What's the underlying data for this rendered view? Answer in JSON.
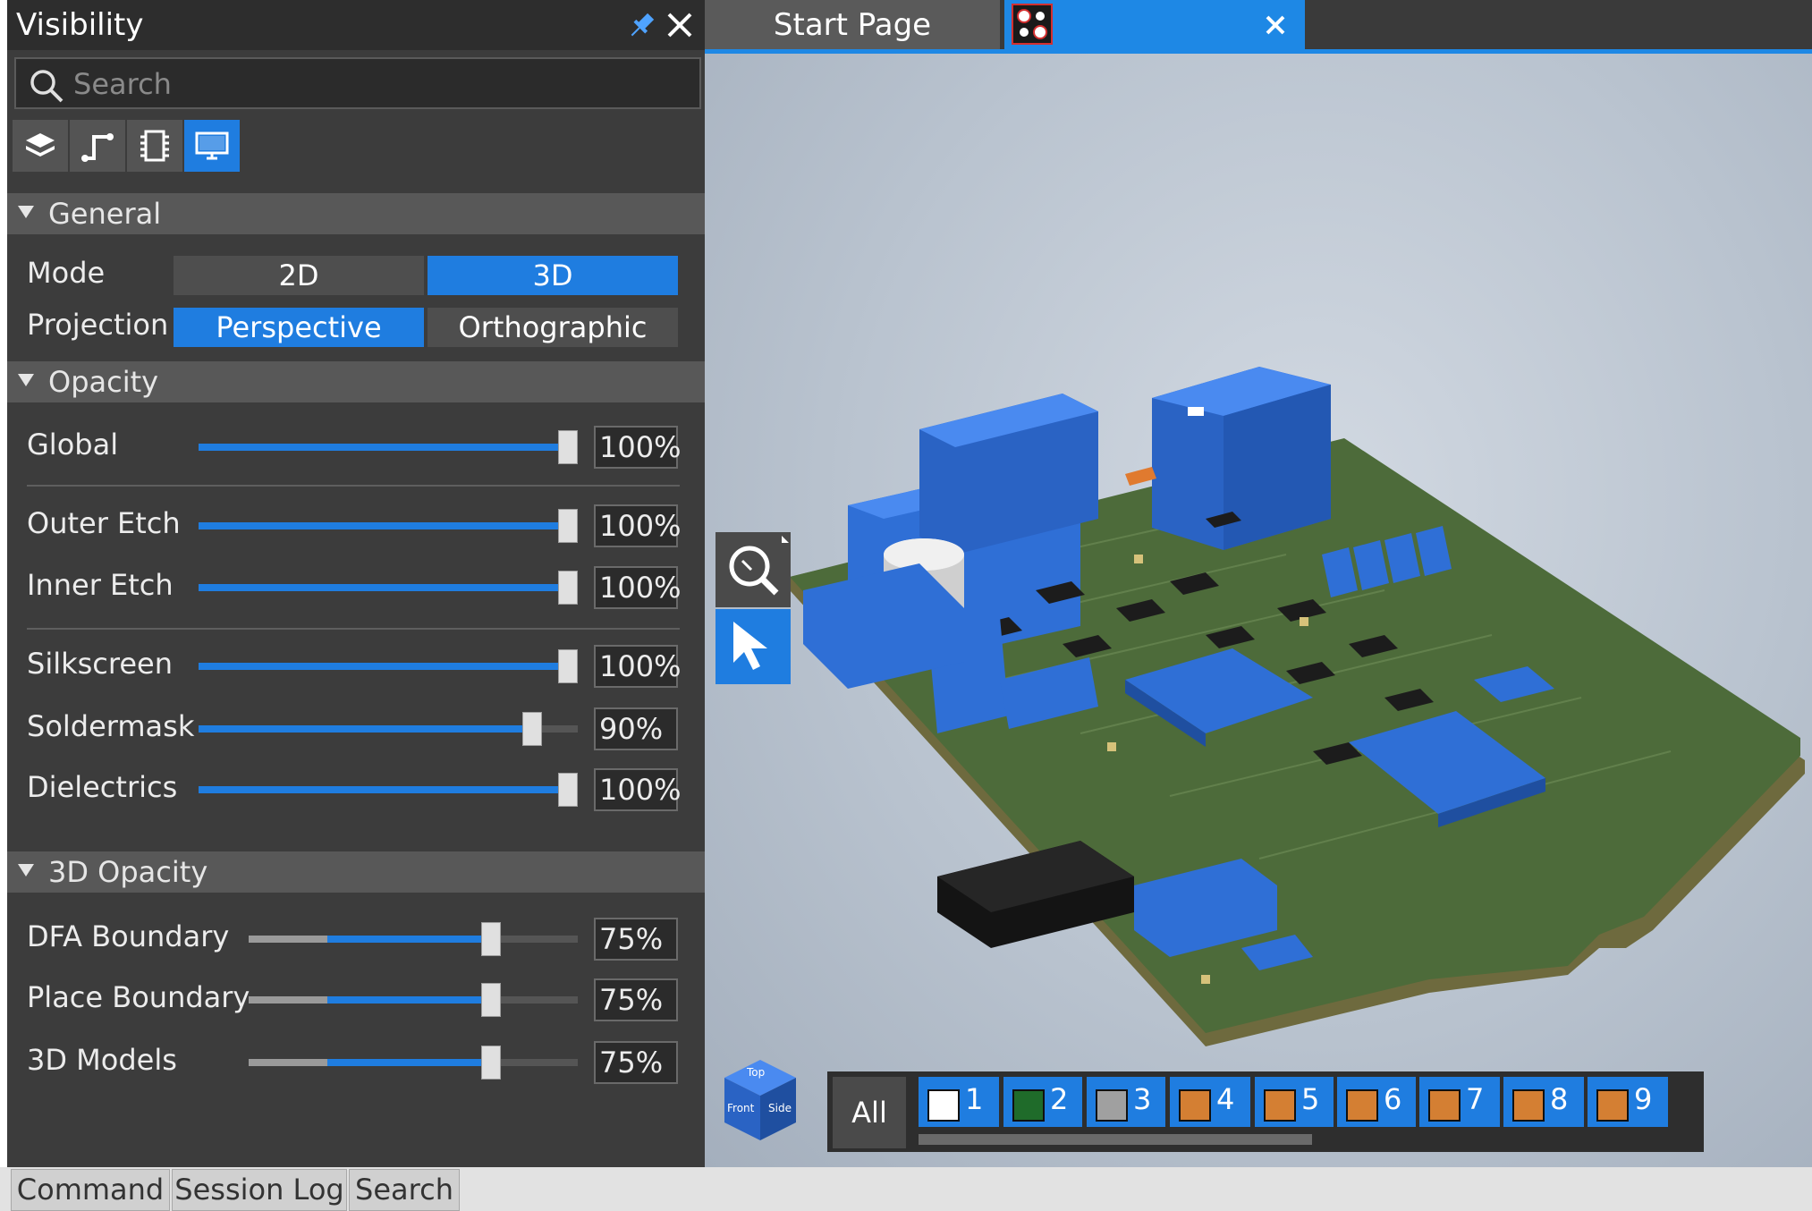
{
  "panel": {
    "title": "Visibility",
    "search_placeholder": "Search",
    "toolbar": [
      {
        "icon": "layers-icon",
        "active": false
      },
      {
        "icon": "trace-route-icon",
        "active": false
      },
      {
        "icon": "component-icon",
        "active": false
      },
      {
        "icon": "display-icon",
        "active": true
      }
    ]
  },
  "general": {
    "header": "General",
    "mode_label": "Mode",
    "mode_options": [
      "2D",
      "3D"
    ],
    "mode_selected": "3D",
    "projection_label": "Projection",
    "projection_options": [
      "Perspective",
      "Orthographic"
    ],
    "projection_selected": "Perspective"
  },
  "opacity": {
    "header": "Opacity",
    "items": [
      {
        "label": "Global",
        "value": "100%",
        "level": 1.0
      },
      {
        "label": "Outer Etch",
        "value": "100%",
        "level": 1.0
      },
      {
        "label": "Inner Etch",
        "value": "100%",
        "level": 1.0
      },
      {
        "label": "Silkscreen",
        "value": "100%",
        "level": 1.0
      },
      {
        "label": "Soldermask",
        "value": "90%",
        "level": 0.9
      },
      {
        "label": "Dielectrics",
        "value": "100%",
        "level": 1.0
      }
    ]
  },
  "opacity3d": {
    "header": "3D Opacity",
    "items": [
      {
        "label": "DFA Boundary",
        "value": "75%",
        "level": 0.75
      },
      {
        "label": "Place Boundary",
        "value": "75%",
        "level": 0.75
      },
      {
        "label": "3D Models",
        "value": "75%",
        "level": 0.75
      }
    ]
  },
  "tabs": {
    "start": "Start Page",
    "board_title": ""
  },
  "layers": {
    "all_label": "All",
    "items": [
      {
        "num": "1",
        "color": "#ffffff"
      },
      {
        "num": "2",
        "color": "#1f6b2a"
      },
      {
        "num": "3",
        "color": "#a0a0a0"
      },
      {
        "num": "4",
        "color": "#d47f33"
      },
      {
        "num": "5",
        "color": "#d47f33"
      },
      {
        "num": "6",
        "color": "#d47f33"
      },
      {
        "num": "7",
        "color": "#d47f33"
      },
      {
        "num": "8",
        "color": "#d47f33"
      },
      {
        "num": "9",
        "color": "#d47f33"
      }
    ]
  },
  "view_cube": {
    "top": "Top",
    "front": "Front",
    "side": "Side"
  },
  "bottom_tabs": [
    "Command",
    "Session Log",
    "Search"
  ],
  "colors": {
    "accent": "#1f7de0",
    "pcb_green": "#4d6b3a",
    "component_blue": "#2f6fd6"
  }
}
